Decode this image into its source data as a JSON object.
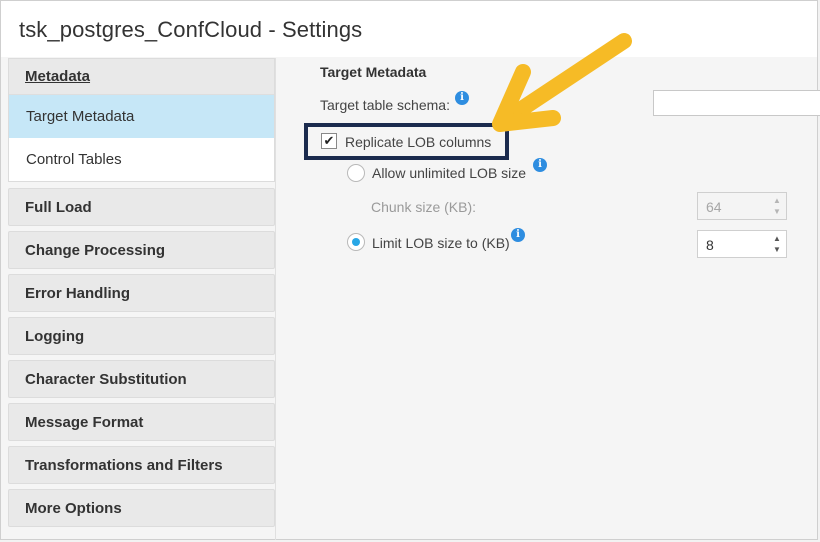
{
  "window": {
    "title": "tsk_postgres_ConfCloud - Settings"
  },
  "sidebar": {
    "metadata_group": {
      "header": "Metadata",
      "items": [
        "Target Metadata",
        "Control Tables"
      ],
      "selected": "Target Metadata"
    },
    "items": [
      "Full Load",
      "Change Processing",
      "Error Handling",
      "Logging",
      "Character Substitution",
      "Message Format",
      "Transformations and Filters",
      "More Options"
    ]
  },
  "content": {
    "section_title": "Target Metadata",
    "target_table_schema": {
      "label": "Target table schema:",
      "value": "",
      "icon": "info-icon"
    },
    "replicate_lob": {
      "label": "Replicate LOB columns",
      "checked": true
    },
    "allow_unlimited": {
      "label": "Allow unlimited LOB size",
      "selected": false,
      "icon": "info-icon"
    },
    "chunk_size": {
      "label": "Chunk size (KB):",
      "value": "64",
      "disabled": true
    },
    "limit_lob": {
      "label": "Limit LOB size to (KB)",
      "selected": true,
      "value": "8",
      "icon": "info-icon"
    }
  },
  "colors": {
    "selected_item_bg": "#c6e7f7",
    "highlight_border": "#1b2b4e",
    "annotation_arrow": "#f6bb26",
    "info_icon": "#2e8de0",
    "radio_selected": "#28a7e6"
  },
  "annotation": {
    "type": "arrow",
    "icon": "arrow-annotation"
  }
}
